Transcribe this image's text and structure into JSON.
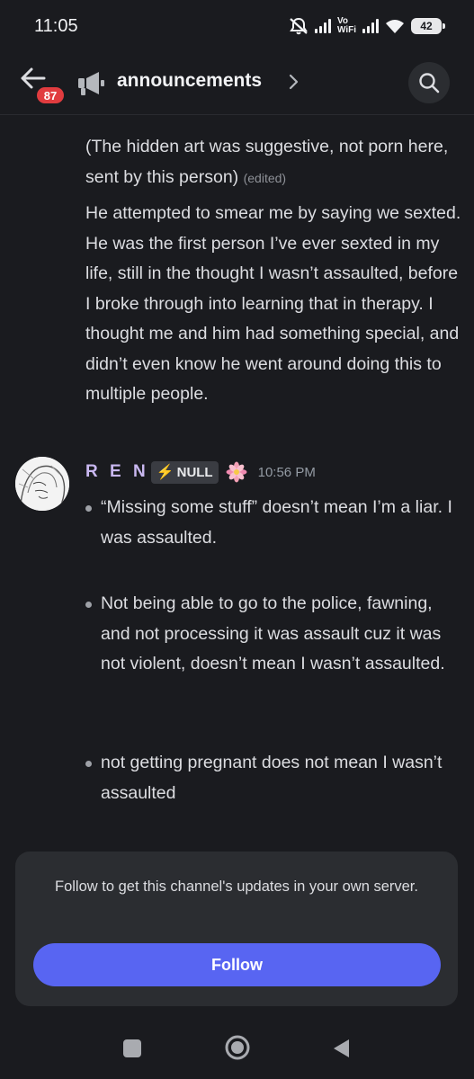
{
  "status_bar": {
    "time": "11:05",
    "vowifi_label": "Vo\nWiFi",
    "battery": "42"
  },
  "header": {
    "unread_count": "87",
    "channel_name": "announcements",
    "icons": [
      "back-arrow-icon",
      "megaphone-icon",
      "chevron-right-icon",
      "search-icon"
    ]
  },
  "messages": {
    "continued": {
      "paragraph1": "(The hidden art was suggestive, not porn here, sent by this person)",
      "edited_label": "(edited)",
      "paragraph2": "He attempted to smear me by saying we sexted. He was the first person I’ve ever sexted in my life, still in the thought I wasn’t assaulted, before I broke through into learning that in therapy. I thought me and him had something special, and didn’t even know he went around doing this to multiple people."
    },
    "ren_message": {
      "author": "R E N",
      "tag": "NULL",
      "time": "10:56 PM",
      "bullets": [
        "“Missing some stuff” doesn’t mean I’m a liar. I was assaulted.",
        "Not being able to go to the police, fawning, and not processing it was assault cuz it was not violent, doesn’t mean I wasn’t assaulted.",
        "not getting pregnant does not mean I wasn’t assaulted"
      ]
    }
  },
  "follow_card": {
    "text": "Follow to get this channel's updates in your own server.",
    "button_label": "Follow"
  },
  "colors": {
    "background": "#1a1b1f",
    "card": "#2b2d31",
    "accent": "#5865f2",
    "badge": "#e13c3f",
    "author": "#c9b8f0"
  }
}
